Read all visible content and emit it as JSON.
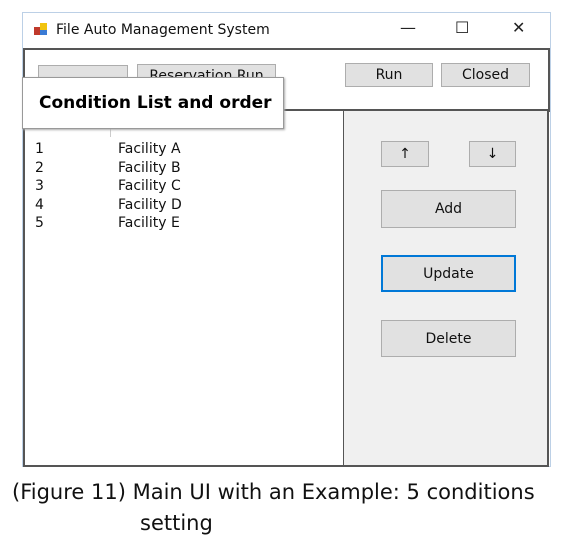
{
  "window": {
    "title": "File Auto Management System",
    "minimize": "—",
    "maximize": "☐",
    "close": "✕"
  },
  "toolbar": {
    "combo_value": "",
    "combo_arrow": "⌄",
    "reservation_run": "Reservation Run",
    "run": "Run",
    "closed": "Closed"
  },
  "callout": "Condition List and order",
  "list": {
    "rows": [
      {
        "no": "1",
        "name": "Facility A"
      },
      {
        "no": "2",
        "name": "Facility B"
      },
      {
        "no": "3",
        "name": "Facility C"
      },
      {
        "no": "4",
        "name": "Facility D"
      },
      {
        "no": "5",
        "name": "Facility E"
      }
    ]
  },
  "side": {
    "up": "↑",
    "down": "↓",
    "add": "Add",
    "update": "Update",
    "delete": "Delete"
  },
  "caption": {
    "line1": "(Figure 11) Main UI with an Example: 5 conditions",
    "line2": "setting"
  },
  "colors": {
    "focus_border": "#0078d7"
  }
}
